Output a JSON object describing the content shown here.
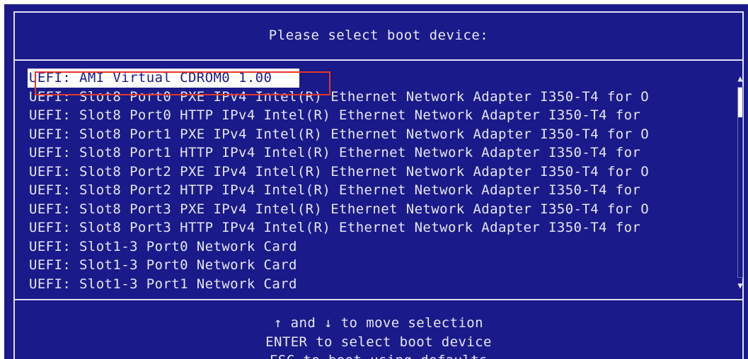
{
  "title": "Please select boot device:",
  "boot_devices": [
    "UEFI: AMI Virtual CDROM0 1.00",
    "UEFI: Slot8 Port0 PXE IPv4 Intel(R) Ethernet Network Adapter I350-T4 for O",
    "UEFI: Slot8 Port0 HTTP IPv4 Intel(R) Ethernet Network Adapter I350-T4 for",
    "UEFI: Slot8 Port1 PXE IPv4 Intel(R) Ethernet Network Adapter I350-T4 for O",
    "UEFI: Slot8 Port1 HTTP IPv4 Intel(R) Ethernet Network Adapter I350-T4 for",
    "UEFI: Slot8 Port2 PXE IPv4 Intel(R) Ethernet Network Adapter I350-T4 for O",
    "UEFI: Slot8 Port2 HTTP IPv4 Intel(R) Ethernet Network Adapter I350-T4 for",
    "UEFI: Slot8 Port3 PXE IPv4 Intel(R) Ethernet Network Adapter I350-T4 for O",
    "UEFI: Slot8 Port3 HTTP IPv4 Intel(R) Ethernet Network Adapter I350-T4 for",
    "UEFI: Slot1-3 Port0 Network Card",
    "UEFI: Slot1-3 Port0 Network Card",
    "UEFI: Slot1-3 Port1 Network Card"
  ],
  "scrollbar": {
    "up_arrow": "▲",
    "down_arrow": "▼"
  },
  "help": {
    "line1": "↑ and ↓ to move selection",
    "line2": "ENTER to select boot device",
    "line3": "ESC to boot using defaults"
  },
  "colors": {
    "background": "#1a1a8a",
    "text": "#e6e6f0",
    "selection_bg": "#ffffff",
    "annotation": "#e0392b"
  }
}
